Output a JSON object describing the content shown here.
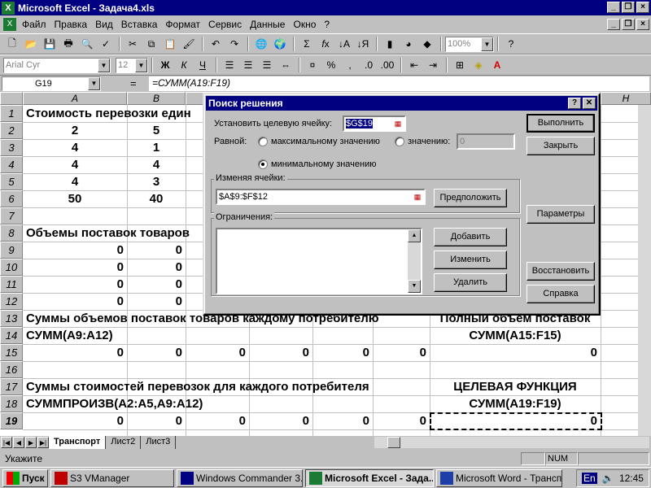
{
  "window": {
    "title": "Microsoft Excel - Задача4.xls"
  },
  "menu": [
    "Файл",
    "Правка",
    "Вид",
    "Вставка",
    "Формат",
    "Сервис",
    "Данные",
    "Окно",
    "?"
  ],
  "toolbar": {
    "font": "Arial Cyr",
    "size": "12",
    "zoom": "100%",
    "bold": "Ж",
    "italic": "К",
    "underline": "Ч"
  },
  "formula_bar": {
    "name_box": "G19",
    "eq": "=",
    "formula": "=СУММ(A19:F19)"
  },
  "grid": {
    "columns": [
      "A",
      "B",
      "H"
    ],
    "rows": [
      "1",
      "2",
      "3",
      "4",
      "5",
      "6",
      "7",
      "8",
      "9",
      "10",
      "11",
      "12",
      "13",
      "14",
      "15",
      "16",
      "17",
      "18",
      "19"
    ],
    "r1": "Стоимость перевозки един",
    "costs": [
      [
        "2",
        "5"
      ],
      [
        "4",
        "1"
      ],
      [
        "4",
        "4"
      ],
      [
        "4",
        "3"
      ],
      [
        "50",
        "40"
      ]
    ],
    "r8": "Объемы поставок товаров",
    "supplies": [
      [
        "0",
        "0"
      ],
      [
        "0",
        "0"
      ],
      [
        "0",
        "0"
      ],
      [
        "0",
        "0"
      ]
    ],
    "r13_left": "Суммы объемов поставок товаров каждому потребителю",
    "r13_right": "Полный объем поставок",
    "r14_left": "СУММ(A9:A12)",
    "r14_right": "СУММ(A15:F15)",
    "r15": [
      "0",
      "0",
      "0",
      "0",
      "0",
      "0",
      "0"
    ],
    "r17_left": "Суммы стоимостей перевозок для каждого потребителя",
    "r17_right": "ЦЕЛЕВАЯ ФУНКЦИЯ",
    "r18_left": "СУММПРОИЗВ(A2:A5,A9:A12)",
    "r18_right": "СУММ(A19:F19)",
    "r19": [
      "0",
      "0",
      "0",
      "0",
      "0",
      "0",
      "0"
    ]
  },
  "sheets": [
    "Транспорт",
    "Лист2",
    "Лист3"
  ],
  "status": {
    "text": "Укажите",
    "num": "NUM"
  },
  "taskbar": {
    "start": "Пуск",
    "items": [
      "S3 VManager",
      "Windows Commander 3.0...",
      "Microsoft Excel - Зада...",
      "Microsoft Word - Трансп..."
    ],
    "lang": "En",
    "clock": "12:45"
  },
  "dialog": {
    "title": "Поиск решения",
    "help": "?",
    "close": "✕",
    "target_label": "Установить целевую ячейку:",
    "target_value": "$G$19",
    "equal_label": "Равной:",
    "opt_max": "максимальному значению",
    "opt_value": "значению:",
    "value_field": "0",
    "opt_min": "минимальному значению",
    "changing_label": "Изменяя ячейки:",
    "changing_value": "$A$9:$F$12",
    "guess": "Предположить",
    "constraints_label": "Ограничения:",
    "add": "Добавить",
    "change": "Изменить",
    "delete": "Удалить",
    "run": "Выполнить",
    "close_btn": "Закрыть",
    "options": "Параметры",
    "reset": "Восстановить",
    "help_btn": "Справка",
    "selected": "min"
  }
}
